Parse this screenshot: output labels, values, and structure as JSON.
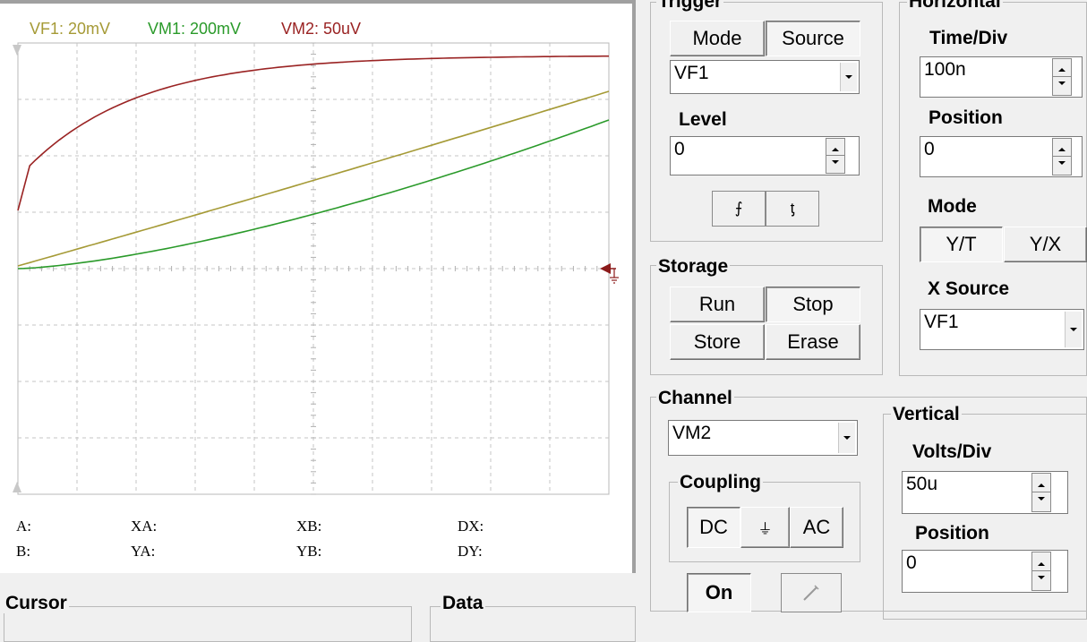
{
  "channels": [
    {
      "label": "VF1: 20mV",
      "color": "#a59a36"
    },
    {
      "label": "VM1: 200mV",
      "color": "#2a9a2a"
    },
    {
      "label": "VM2: 50uV",
      "color": "#9a2323"
    }
  ],
  "cursor_readouts": {
    "a": "A:",
    "b": "B:",
    "xa": "XA:",
    "ya": "YA:",
    "xb": "XB:",
    "yb": "YB:",
    "dx": "DX:",
    "dy": "DY:"
  },
  "bottom_groups": {
    "cursor": "Cursor",
    "data": "Data"
  },
  "trigger": {
    "title": "Trigger",
    "mode_label": "Mode",
    "source_label": "Source",
    "source_value": "VF1",
    "level_label": "Level",
    "level_value": "0",
    "rising_glyph": "⨍",
    "falling_glyph": "ƫ"
  },
  "horizontal": {
    "title": "Horizontal",
    "timediv_label": "Time/Div",
    "timediv_value": "100n",
    "position_label": "Position",
    "position_value": "0",
    "mode_label": "Mode",
    "yt_label": "Y/T",
    "yx_label": "Y/X",
    "xsource_label": "X Source",
    "xsource_value": "VF1"
  },
  "storage": {
    "title": "Storage",
    "run": "Run",
    "stop": "Stop",
    "store": "Store",
    "erase": "Erase"
  },
  "channel": {
    "title": "Channel",
    "value": "VM2",
    "coupling_label": "Coupling",
    "dc": "DC",
    "gnd": "⏚",
    "ac": "AC",
    "on": "On"
  },
  "vertical": {
    "title": "Vertical",
    "voltsdiv_label": "Volts/Div",
    "voltsdiv_value": "50u",
    "position_label": "Position",
    "position_value": "0"
  }
}
